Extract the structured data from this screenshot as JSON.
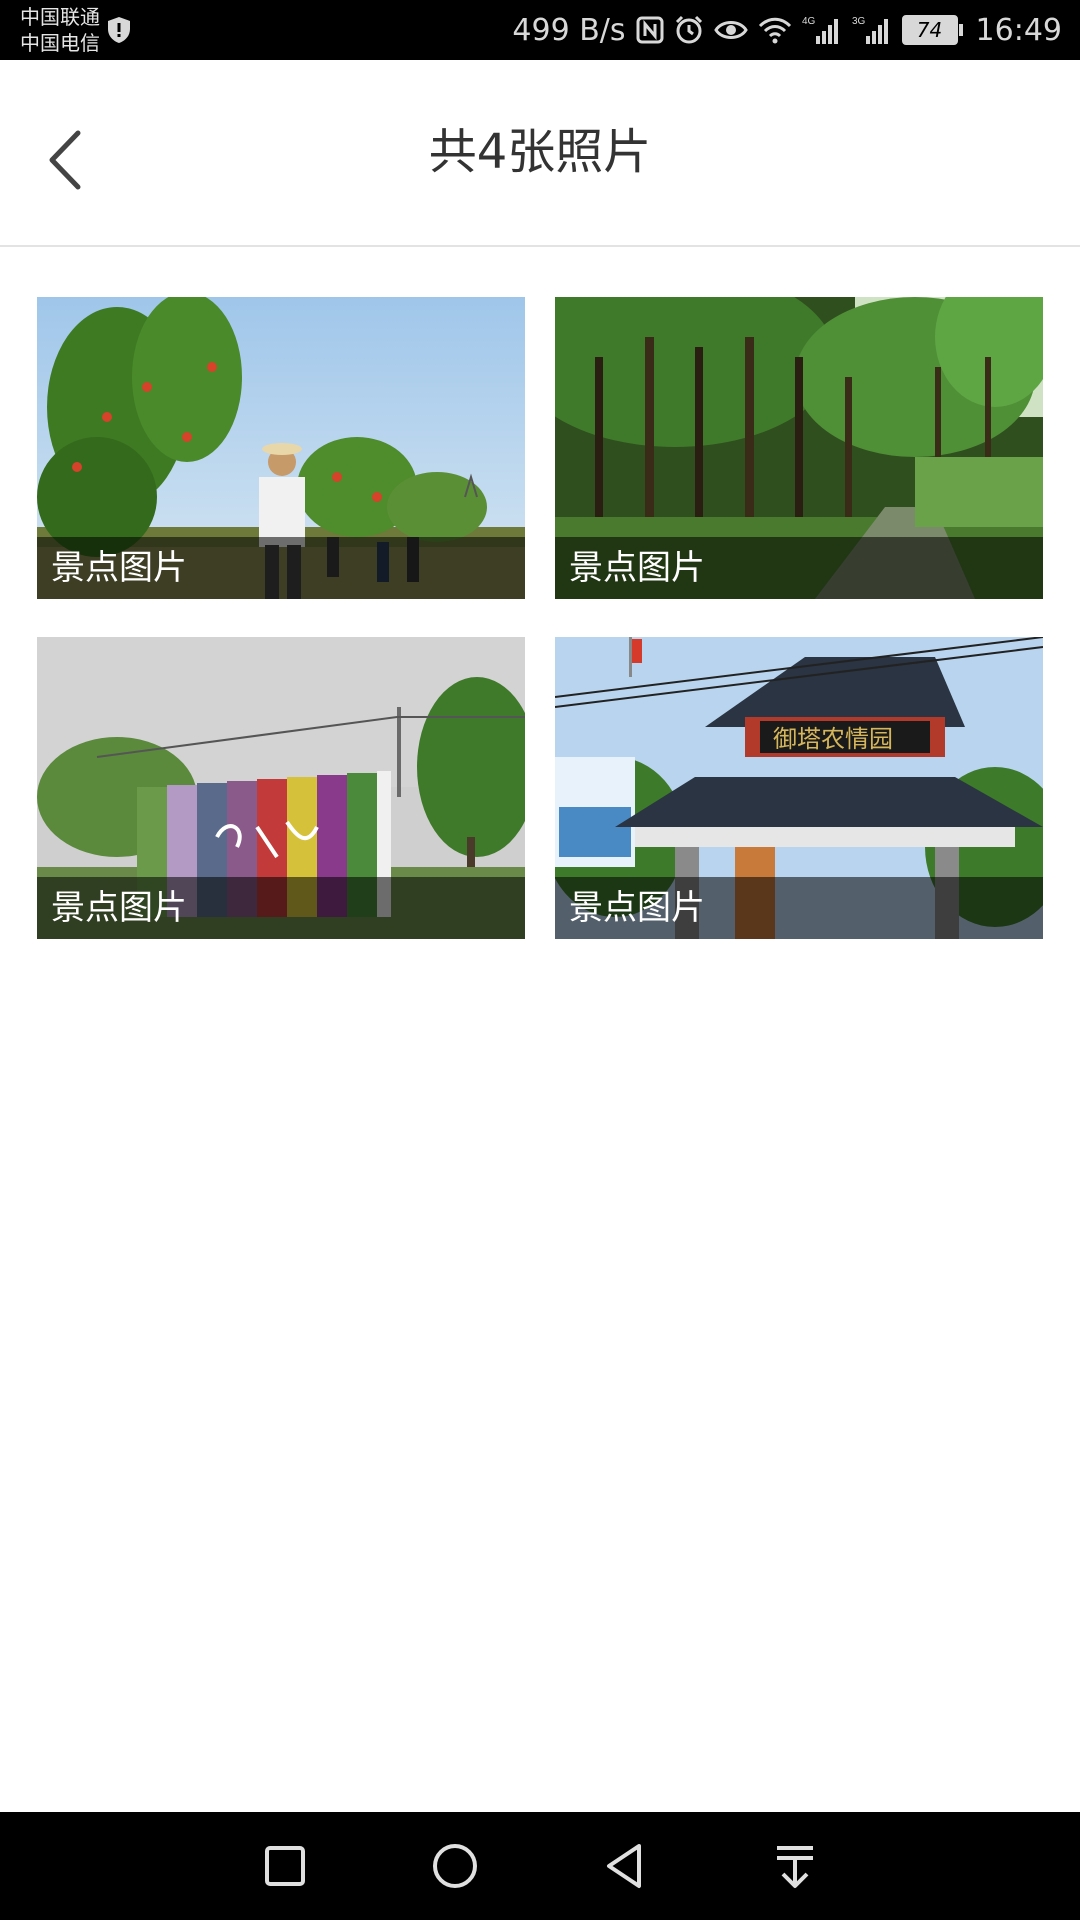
{
  "status_bar": {
    "carrier_1": "中国联通",
    "carrier_2": "中国电信",
    "net_speed": "499 B/s",
    "battery": "74",
    "time": "16:49",
    "icons": [
      "shield-icon",
      "nfc-icon",
      "alarm-icon",
      "eye-icon",
      "wifi-icon",
      "signal-4g-icon",
      "signal-3g-icon",
      "battery-icon"
    ]
  },
  "header": {
    "title": "共4张照片",
    "back_icon": "chevron-left-icon"
  },
  "photos": [
    {
      "caption": "景点图片",
      "scene": "fruit-trees-people"
    },
    {
      "caption": "景点图片",
      "scene": "forest-path"
    },
    {
      "caption": "景点图片",
      "scene": "flower-wall"
    },
    {
      "caption": "景点图片",
      "scene": "gate-pavilion"
    }
  ],
  "nav_bar": {
    "buttons": [
      "recent-apps-icon",
      "home-icon",
      "back-icon",
      "notification-pull-icon"
    ]
  },
  "colors": {
    "status_bar_bg": "#000000",
    "header_bg": "#ffffff",
    "title_text": "#333333",
    "caption_overlay": "rgba(0,0,0,0.55)"
  }
}
